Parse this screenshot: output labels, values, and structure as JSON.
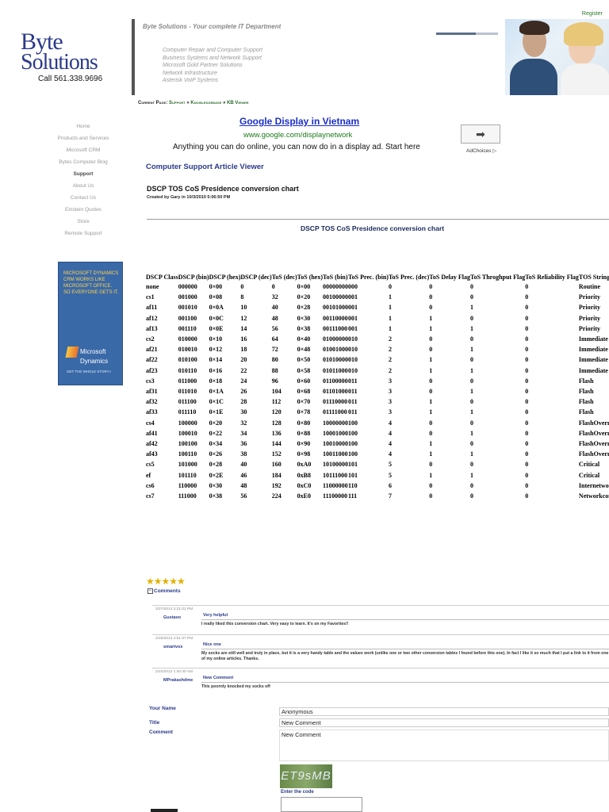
{
  "header": {
    "register": "Register",
    "logo_line1": "Byte",
    "logo_line2": "Solutions",
    "phone": "Call 561.338.9696",
    "tagline": "Byte Solutions - Your complete IT Department",
    "services": [
      "Computer Repair and Computer Support",
      "Business Systems and Network Support",
      "Microsoft Gold Partner Solutions",
      "Network Infrastructure",
      "Asterisk VoIP Systems"
    ]
  },
  "breadcrumb": {
    "label": "Current Page:",
    "items": [
      "Support",
      "Knowledgebase",
      "KB Viewer"
    ],
    "sep": "»"
  },
  "nav": [
    "Home",
    "Products and Services",
    "Microsoft CRM",
    "Bytes Computer Blog",
    "Support",
    "About Us",
    "Contact Us",
    "Einstein Quotes",
    "Store",
    "Remote Support"
  ],
  "nav_active": "Support",
  "ms_ad": {
    "text": "MICROSOFT DYNAMICS CRM WORKS LIKE MICROSOFT OFFICE. SO EVERYONE GETS IT.",
    "brand1": "Microsoft",
    "brand2": "Dynamics",
    "tag": "GET THE WHOLE STORY»"
  },
  "google_ad": {
    "title": "Google Display in Vietnam",
    "url": "www.google.com/displaynetwork",
    "text": "Anything you can do online, you can now do in a display ad. Start here",
    "button": "➡",
    "adchoices": "AdChoices ▷"
  },
  "viewer_title": "Computer Support Article Viewer",
  "article": {
    "title": "DSCP TOS CoS Presidence conversion chart",
    "meta": "Created by Gary in 10/3/2010 5:06:50 PM",
    "chart_title": "DSCP TOS CoS Presidence conversion chart"
  },
  "table": {
    "headers": [
      "DSCP Class",
      "DSCP (bin)",
      "DSCP (hex)",
      "DSCP (dec)",
      "ToS (dec)",
      "ToS (hex)",
      "ToS (bin)",
      "ToS Prec. (bin)",
      "ToS Prec. (dec)",
      "ToS Delay Flag",
      "ToS Throghput Flag",
      "ToS Reliability Flag",
      "TOS String Format"
    ],
    "rows": [
      [
        "none",
        "000000",
        "0×00",
        "0",
        "0",
        "0×00",
        "00000000",
        "000",
        "0",
        "0",
        "0",
        "0",
        "Routine"
      ],
      [
        "cs1",
        "001000",
        "0×08",
        "8",
        "32",
        "0×20",
        "00100000",
        "001",
        "1",
        "0",
        "0",
        "0",
        "Priority"
      ],
      [
        "af11",
        "001010",
        "0×0A",
        "10",
        "40",
        "0×28",
        "00101000",
        "001",
        "1",
        "0",
        "1",
        "0",
        "Priority"
      ],
      [
        "af12",
        "001100",
        "0×0C",
        "12",
        "48",
        "0×30",
        "00110000",
        "001",
        "1",
        "1",
        "0",
        "0",
        "Priority"
      ],
      [
        "af13",
        "001110",
        "0×0E",
        "14",
        "56",
        "0×38",
        "00111000",
        "001",
        "1",
        "1",
        "1",
        "0",
        "Priority"
      ],
      [
        "cs2",
        "010000",
        "0×10",
        "16",
        "64",
        "0×40",
        "01000000",
        "010",
        "2",
        "0",
        "0",
        "0",
        "Immediate"
      ],
      [
        "af21",
        "010010",
        "0×12",
        "18",
        "72",
        "0×48",
        "01001000",
        "010",
        "2",
        "0",
        "1",
        "0",
        "Immediate"
      ],
      [
        "af22",
        "010100",
        "0×14",
        "20",
        "80",
        "0×50",
        "01010000",
        "010",
        "2",
        "1",
        "0",
        "0",
        "Immediate"
      ],
      [
        "af23",
        "010110",
        "0×16",
        "22",
        "88",
        "0×58",
        "01011000",
        "010",
        "2",
        "1",
        "1",
        "0",
        "Immediate"
      ],
      [
        "cs3",
        "011000",
        "0×18",
        "24",
        "96",
        "0×60",
        "01100000",
        "011",
        "3",
        "0",
        "0",
        "0",
        "Flash"
      ],
      [
        "af31",
        "011010",
        "0×1A",
        "26",
        "104",
        "0×68",
        "01101000",
        "011",
        "3",
        "0",
        "1",
        "0",
        "Flash"
      ],
      [
        "af32",
        "011100",
        "0×1C",
        "28",
        "112",
        "0×70",
        "01110000",
        "011",
        "3",
        "1",
        "0",
        "0",
        "Flash"
      ],
      [
        "af33",
        "011110",
        "0×1E",
        "30",
        "120",
        "0×78",
        "01111000",
        "011",
        "3",
        "1",
        "1",
        "0",
        "Flash"
      ],
      [
        "cs4",
        "100000",
        "0×20",
        "32",
        "128",
        "0×80",
        "10000000",
        "100",
        "4",
        "0",
        "0",
        "0",
        "FlashOverride"
      ],
      [
        "af41",
        "100010",
        "0×22",
        "34",
        "136",
        "0×88",
        "10001000",
        "100",
        "4",
        "0",
        "1",
        "0",
        "FlashOverride"
      ],
      [
        "af42",
        "100100",
        "0×34",
        "36",
        "144",
        "0×90",
        "10010000",
        "100",
        "4",
        "1",
        "0",
        "0",
        "FlashOverride"
      ],
      [
        "af43",
        "100110",
        "0×26",
        "38",
        "152",
        "0×98",
        "10011000",
        "100",
        "4",
        "1",
        "1",
        "0",
        "FlashOverride"
      ],
      [
        "cs5",
        "101000",
        "0×28",
        "40",
        "160",
        "0xA0",
        "10100000",
        "101",
        "5",
        "0",
        "0",
        "0",
        "Critical"
      ],
      [
        "ef",
        "101110",
        "0×2E",
        "46",
        "184",
        "0xB8",
        "10111000",
        "101",
        "5",
        "1",
        "1",
        "0",
        "Critical"
      ],
      [
        "cs6",
        "110000",
        "0×30",
        "48",
        "192",
        "0xC0",
        "11000000",
        "110",
        "6",
        "0",
        "0",
        "0",
        "Internetworkcontrol"
      ],
      [
        "cs7",
        "111000",
        "0×38",
        "56",
        "224",
        "0xE0",
        "11100000",
        "111",
        "7",
        "0",
        "0",
        "0",
        "Networkcontrol"
      ]
    ]
  },
  "rating": "★★★★★",
  "comments_label": "Comments",
  "comments_toggle": "−",
  "comments": [
    {
      "date": "3/27/2013 3:21:01 PM",
      "author": "Gustavo",
      "title": "Very helpful",
      "body": "I really liked this conversion chart. Very easy to learn. It's on my Favorites!!"
    },
    {
      "date": "4/26/2013 4:51:37 PM",
      "author": "smartvox",
      "title": "Nice one",
      "body": "My socks are still well and truly in place, but it is a very handy table and the values work (unlike one or two other conversion tables I found before this one). In fact I like it so much that I put a link to it from one of my online articles. Thanks."
    },
    {
      "date": "2/24/2012 1:40:40 AM",
      "author": "MPrakashdme",
      "title": "New Comment",
      "body": "This poornly knocked my socks off"
    }
  ],
  "form": {
    "name_label": "Your Name",
    "name_value": "Anonymous",
    "title_label": "Title",
    "title_value": "New Comment",
    "comment_label": "Comment",
    "comment_value": "New Comment",
    "captcha": "ET9sMB",
    "code_label": "Enter the code"
  },
  "colors": {
    "brand": "#2b3a8a",
    "link_green": "#2a7a2a",
    "ad_blue": "#1a2ec8",
    "ms_blue": "#3a69a8"
  }
}
